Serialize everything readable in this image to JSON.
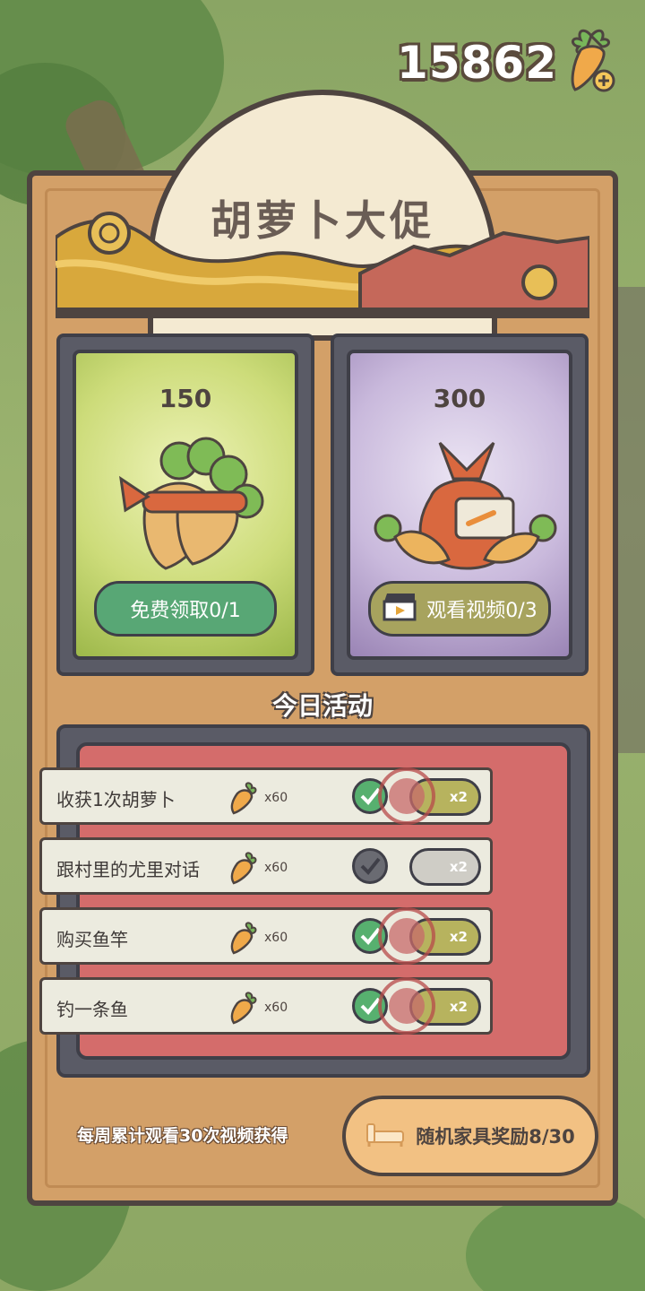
{
  "currency": {
    "amount": "15862"
  },
  "title": "胡萝卜大促",
  "cards": [
    {
      "price": "150",
      "button_label": "免费领取0/1"
    },
    {
      "price": "300",
      "button_label": "观看视频0/3"
    }
  ],
  "daily": {
    "heading": "今日活动",
    "tasks": [
      {
        "label": "收获1次胡萝卜",
        "reward": "x60",
        "multiplier": "x2",
        "completed": true
      },
      {
        "label": "跟村里的尤里对话",
        "reward": "x60",
        "multiplier": "x2",
        "completed": false
      },
      {
        "label": "购买鱼竿",
        "reward": "x60",
        "multiplier": "x2",
        "completed": true
      },
      {
        "label": "钓一条鱼",
        "reward": "x60",
        "multiplier": "x2",
        "completed": true
      }
    ]
  },
  "weekly": {
    "description": "每周累计观看30次视频获得",
    "button_label": "随机家具奖励8/30"
  },
  "colors": {
    "panel": "#d3a068",
    "task_board": "#d46c6b",
    "free_button": "#58a775",
    "video_button": "#a7a35e"
  }
}
